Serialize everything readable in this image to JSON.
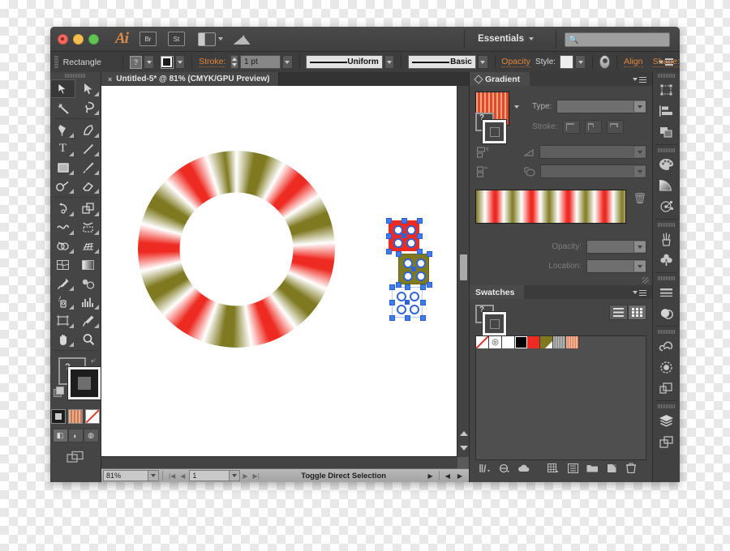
{
  "app": {
    "name": "Adobe Illustrator",
    "logo_text": "Ai",
    "bridge_label": "Br",
    "stock_label": "St",
    "workspace": "Essentials",
    "search_placeholder": ""
  },
  "control_bar": {
    "object_label": "Rectangle",
    "fill_value": "?",
    "stroke_label": "Stroke:",
    "stroke_weight": "1 pt",
    "stroke_profile": "Uniform",
    "brush_definition": "Basic",
    "opacity_label": "Opacity",
    "style_label": "Style:",
    "align_label": "Align",
    "shape_label": "Shape:"
  },
  "document": {
    "tab_title": "Untitled-5* @ 81% (CMYK/GPU Preview)",
    "close_glyph": "×"
  },
  "status_bar": {
    "zoom": "81%",
    "artboard_number": "1",
    "tool_status": "Toggle Direct Selection"
  },
  "tools": [
    {
      "name": "selection-tool",
      "glyph": "selection",
      "selected": true
    },
    {
      "name": "direct-selection-tool",
      "glyph": "direct-selection",
      "selected": false
    },
    {
      "name": "magic-wand-tool",
      "glyph": "magic-wand",
      "selected": false
    },
    {
      "name": "lasso-tool",
      "glyph": "lasso",
      "selected": false
    },
    {
      "name": "pen-tool",
      "glyph": "pen",
      "selected": false
    },
    {
      "name": "curvature-tool",
      "glyph": "curvature",
      "selected": false
    },
    {
      "name": "type-tool",
      "glyph": "type",
      "selected": false
    },
    {
      "name": "line-segment-tool",
      "glyph": "line",
      "selected": false
    },
    {
      "name": "rectangle-tool",
      "glyph": "rectangle",
      "selected": false
    },
    {
      "name": "paintbrush-tool",
      "glyph": "paintbrush",
      "selected": false
    },
    {
      "name": "shaper-tool",
      "glyph": "shaper",
      "selected": false
    },
    {
      "name": "eraser-tool",
      "glyph": "eraser",
      "selected": false
    },
    {
      "name": "rotate-tool",
      "glyph": "rotate",
      "selected": false
    },
    {
      "name": "scale-tool",
      "glyph": "scale",
      "selected": false
    },
    {
      "name": "width-tool",
      "glyph": "width",
      "selected": false
    },
    {
      "name": "free-transform-tool",
      "glyph": "free-transform",
      "selected": false
    },
    {
      "name": "shape-builder-tool",
      "glyph": "shape-builder",
      "selected": false
    },
    {
      "name": "perspective-grid-tool",
      "glyph": "perspective-grid",
      "selected": false
    },
    {
      "name": "mesh-tool",
      "glyph": "mesh",
      "selected": false
    },
    {
      "name": "gradient-tool",
      "glyph": "gradient",
      "selected": false
    },
    {
      "name": "eyedropper-tool",
      "glyph": "eyedropper",
      "selected": false
    },
    {
      "name": "blend-tool",
      "glyph": "blend",
      "selected": false
    },
    {
      "name": "symbol-sprayer-tool",
      "glyph": "symbol-sprayer",
      "selected": false
    },
    {
      "name": "column-graph-tool",
      "glyph": "column-graph",
      "selected": false
    },
    {
      "name": "artboard-tool",
      "glyph": "artboard",
      "selected": false
    },
    {
      "name": "slice-tool",
      "glyph": "slice",
      "selected": false
    },
    {
      "name": "hand-tool",
      "glyph": "hand",
      "selected": false
    },
    {
      "name": "zoom-tool",
      "glyph": "zoom",
      "selected": false
    }
  ],
  "fill_stroke": {
    "fill_question": "?",
    "fill_color": "#1d1d1d",
    "stroke_color": "none"
  },
  "gradient_panel": {
    "title": "Gradient",
    "type_label": "Type:",
    "stroke_label": "Stroke:",
    "opacity_label": "Opacity:",
    "location_label": "Location:",
    "type_value": "",
    "opacity_value": "",
    "location_value": "",
    "thumb_pattern": "stripe-orange",
    "gradient_stops_colors": [
      "#7f7a22",
      "#ffffff",
      "#ee2b22",
      "#ffffff"
    ]
  },
  "swatches_panel": {
    "title": "Swatches",
    "swatches": [
      {
        "name": "none",
        "color": "#ffffff",
        "kind": "none"
      },
      {
        "name": "registration",
        "color": "#ffffff",
        "kind": "registration"
      },
      {
        "name": "white",
        "color": "#ffffff",
        "kind": "solid"
      },
      {
        "name": "black",
        "color": "#000000",
        "kind": "solid"
      },
      {
        "name": "red",
        "color": "#ee2b22",
        "kind": "solid"
      },
      {
        "name": "olive",
        "color": "#7f7a22",
        "kind": "corner"
      },
      {
        "name": "gray-stripe",
        "color": "#9a9a9a",
        "kind": "pattern-gray"
      },
      {
        "name": "orange-stripe",
        "color": "#e0815c",
        "kind": "pattern-orange"
      }
    ],
    "footer_icons": [
      "swatch-libraries-icon",
      "show-swatch-kinds-icon",
      "libraries-icon",
      "swatch-options-icon",
      "new-color-group-icon",
      "new-swatch-icon",
      "delete-swatch-icon"
    ]
  },
  "icon_rail": {
    "groups": [
      [
        "transform-icon",
        "align-icon",
        "pathfinder-icon"
      ],
      [
        "color-icon",
        "color-guide-icon",
        "image-trace-icon"
      ],
      [
        "brushes-icon",
        "symbols-icon"
      ],
      [
        "stroke-icon",
        "transparency-icon"
      ],
      [
        "creative-cloud-icon",
        "libraries-icon",
        "artboards-icon"
      ],
      [
        "layers-icon",
        "artboard-panel-icon"
      ]
    ]
  },
  "artwork": {
    "ring_description": "striped-donut-conic-gradient",
    "ring_colors": [
      "#7f7a22",
      "#ffffff",
      "#ee2b22"
    ],
    "selected_objects": [
      {
        "name": "die-red",
        "fill": "#ee2b22",
        "pips": 5
      },
      {
        "name": "die-olive",
        "fill": "#7f7a22",
        "pips": 5
      },
      {
        "name": "die-white",
        "fill": "#ffffff",
        "pips": 5
      }
    ],
    "selection_color": "#3f7bf0"
  }
}
